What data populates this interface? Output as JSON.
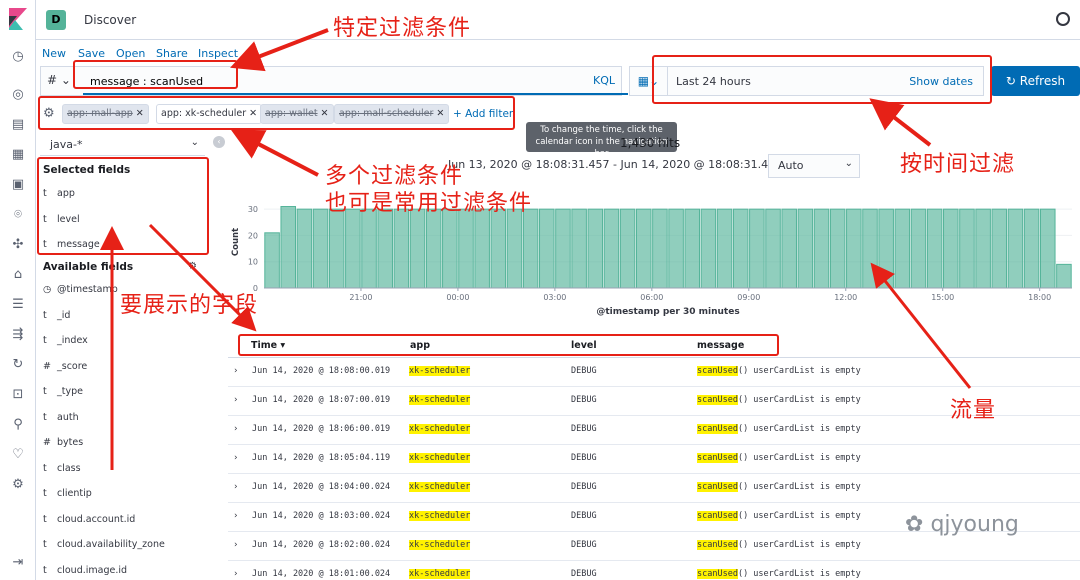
{
  "app": {
    "title": "Discover",
    "space_initial": "D"
  },
  "menu": {
    "items": [
      "New",
      "Save",
      "Open",
      "Share",
      "Inspect"
    ]
  },
  "query": {
    "language_symbol": "#",
    "value": "message : scanUsed",
    "language_label": "KQL"
  },
  "time": {
    "range_label": "Last 24 hours",
    "show_dates": "Show dates",
    "refresh_label": "Refresh"
  },
  "filters": {
    "items": [
      {
        "label": "app: mall-app",
        "enabled": false
      },
      {
        "label": "app: xk-scheduler",
        "enabled": true
      },
      {
        "label": "app: wallet",
        "enabled": false
      },
      {
        "label": "app: mall-scheduler",
        "enabled": false
      }
    ],
    "add_label": "+ Add filter"
  },
  "sidebar": {
    "index_pattern": "java-*",
    "selected_heading": "Selected fields",
    "selected_fields": [
      {
        "type": "t",
        "name": "app"
      },
      {
        "type": "t",
        "name": "level"
      },
      {
        "type": "t",
        "name": "message"
      }
    ],
    "available_heading": "Available fields",
    "available_fields": [
      {
        "type": "◷",
        "name": "@timestamp"
      },
      {
        "type": "t",
        "name": "_id"
      },
      {
        "type": "t",
        "name": "_index"
      },
      {
        "type": "#",
        "name": "_score"
      },
      {
        "type": "t",
        "name": "_type"
      },
      {
        "type": "t",
        "name": "auth"
      },
      {
        "type": "#",
        "name": "bytes"
      },
      {
        "type": "t",
        "name": "class"
      },
      {
        "type": "t",
        "name": "clientip"
      },
      {
        "type": "t",
        "name": "cloud.account.id"
      },
      {
        "type": "t",
        "name": "cloud.availability_zone"
      },
      {
        "type": "t",
        "name": "cloud.image.id"
      }
    ]
  },
  "histogram": {
    "hits": "1,430 hits",
    "range_text": "Jun 13, 2020 @ 18:08:31.457 - Jun 14, 2020 @ 18:08:31.457 —",
    "interval": "Auto",
    "tooltip": "To change the time, click the calendar icon in the navigation bar"
  },
  "chart_data": {
    "type": "bar",
    "xlabel": "@timestamp per 30 minutes",
    "ylabel": "Count",
    "ylim": [
      0,
      35
    ],
    "yticks": [
      0,
      10,
      20,
      30
    ],
    "xticks": [
      "21:00",
      "00:00",
      "03:00",
      "06:00",
      "09:00",
      "12:00",
      "15:00",
      "18:00"
    ],
    "color": "#54b399",
    "values": [
      21,
      31,
      30,
      30,
      30,
      30,
      30,
      30,
      30,
      30,
      30,
      30,
      30,
      30,
      30,
      30,
      30,
      30,
      30,
      30,
      30,
      30,
      30,
      30,
      30,
      30,
      30,
      30,
      30,
      30,
      30,
      30,
      30,
      30,
      30,
      30,
      30,
      30,
      30,
      30,
      30,
      30,
      30,
      30,
      30,
      30,
      30,
      30,
      30,
      9
    ]
  },
  "table": {
    "columns": [
      "Time",
      "app",
      "level",
      "message"
    ],
    "rows": [
      {
        "time": "Jun 14, 2020 @ 18:08:00.019",
        "app": "xk-scheduler",
        "level": "DEBUG",
        "msg_hl": "scanUsed",
        "msg_rest": "() userCardList is empty"
      },
      {
        "time": "Jun 14, 2020 @ 18:07:00.019",
        "app": "xk-scheduler",
        "level": "DEBUG",
        "msg_hl": "scanUsed",
        "msg_rest": "() userCardList is empty"
      },
      {
        "time": "Jun 14, 2020 @ 18:06:00.019",
        "app": "xk-scheduler",
        "level": "DEBUG",
        "msg_hl": "scanUsed",
        "msg_rest": "() userCardList is empty"
      },
      {
        "time": "Jun 14, 2020 @ 18:05:04.119",
        "app": "xk-scheduler",
        "level": "DEBUG",
        "msg_hl": "scanUsed",
        "msg_rest": "() userCardList is empty"
      },
      {
        "time": "Jun 14, 2020 @ 18:04:00.024",
        "app": "xk-scheduler",
        "level": "DEBUG",
        "msg_hl": "scanUsed",
        "msg_rest": "() userCardList is empty"
      },
      {
        "time": "Jun 14, 2020 @ 18:03:00.024",
        "app": "xk-scheduler",
        "level": "DEBUG",
        "msg_hl": "scanUsed",
        "msg_rest": "() userCardList is empty"
      },
      {
        "time": "Jun 14, 2020 @ 18:02:00.024",
        "app": "xk-scheduler",
        "level": "DEBUG",
        "msg_hl": "scanUsed",
        "msg_rest": "() userCardList is empty"
      },
      {
        "time": "Jun 14, 2020 @ 18:01:00.024",
        "app": "xk-scheduler",
        "level": "DEBUG",
        "msg_hl": "scanUsed",
        "msg_rest": "() userCardList is empty"
      }
    ]
  },
  "annotations": {
    "filter_condition": "特定过滤条件",
    "multi_filter_1": "多个过滤条件",
    "multi_filter_2": "也可是常用过滤条件",
    "time_filter": "按时间过滤",
    "fields": "要展示的字段",
    "traffic": "流量",
    "watermark": "qjyoung"
  }
}
